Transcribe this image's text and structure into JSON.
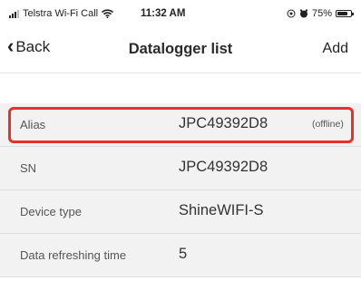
{
  "status_bar": {
    "carrier": "Telstra Wi-Fi Call",
    "time": "11:32 AM",
    "battery": "75%",
    "battery_level": 0.75,
    "icons": [
      "signal-icon",
      "wifi-icon",
      "location-icon",
      "alarm-icon",
      "battery-icon"
    ]
  },
  "nav": {
    "back_label": "Back",
    "title": "Datalogger list",
    "add_label": "Add"
  },
  "rows": [
    {
      "label": "Alias",
      "value": "JPC49392D8",
      "status": "(offline)"
    },
    {
      "label": "SN",
      "value": "JPC49392D8"
    },
    {
      "label": "Device type",
      "value": "ShineWIFI-S"
    },
    {
      "label": "Data refreshing time",
      "value": "5"
    }
  ],
  "colors": {
    "highlight": "#e8312c",
    "row_background": "#f2f2f2"
  }
}
